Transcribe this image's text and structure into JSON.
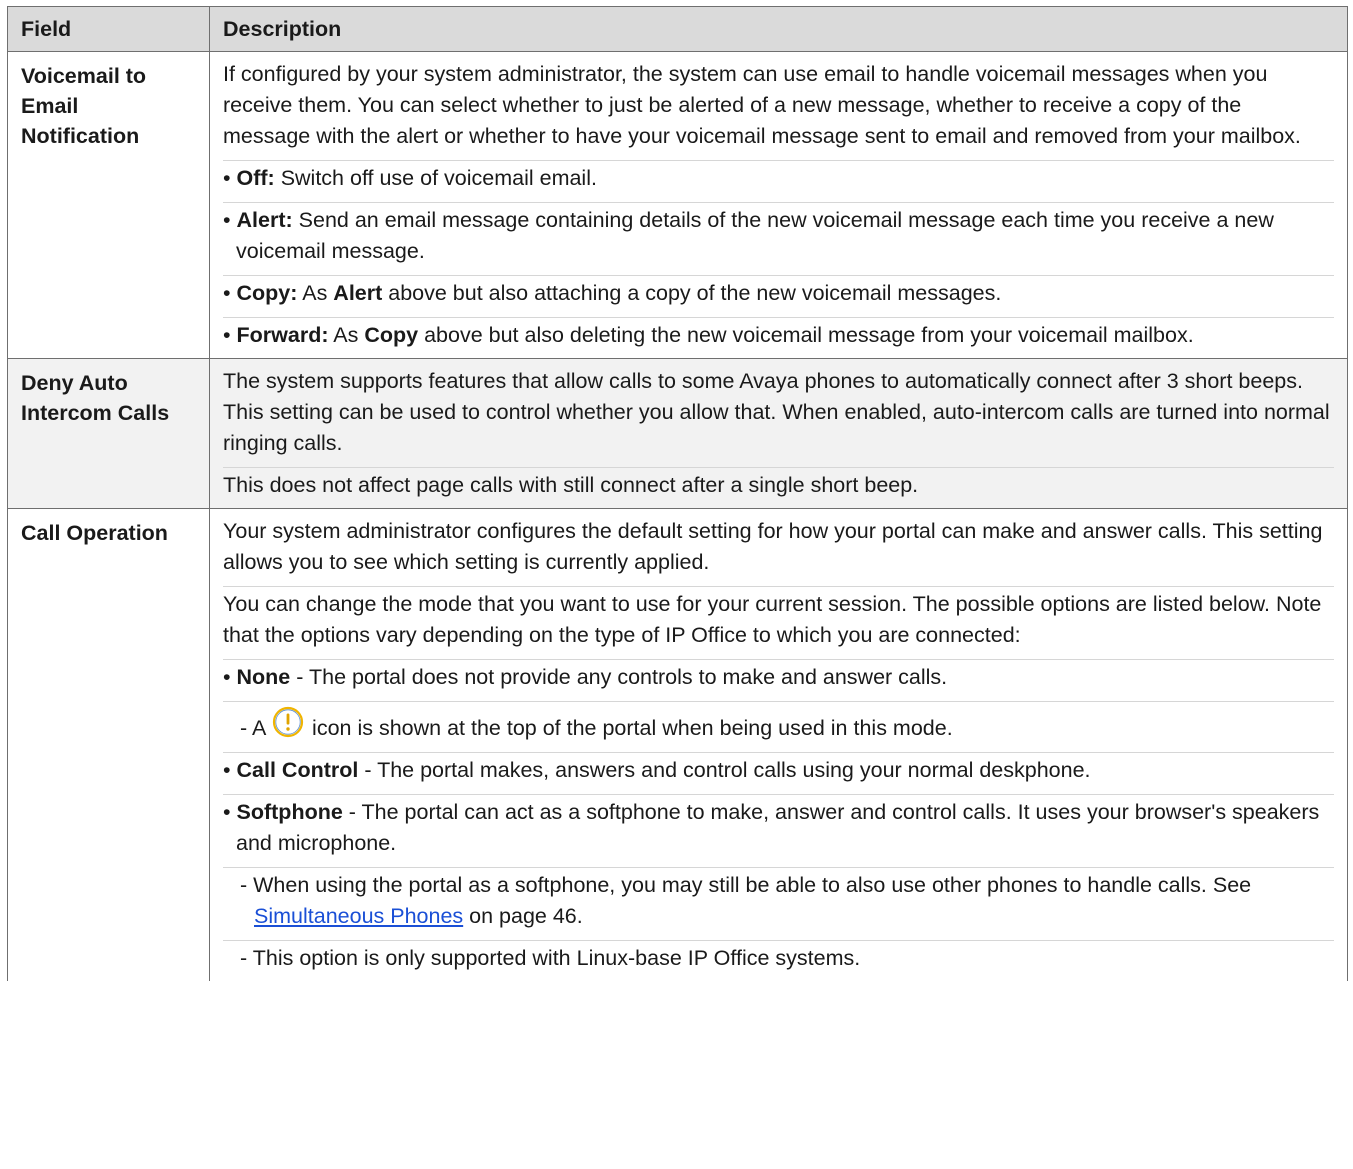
{
  "header": {
    "field": "Field",
    "description": "Description"
  },
  "rows": [
    {
      "field": "Voicemail to Email Notification",
      "intro": "If configured by your system administrator, the system can use email to handle voicemail messages when you receive them. You can select whether to just be alerted of a new message, whether to receive a copy of the message with the alert or whether to have your voicemail message sent to email and removed from your mailbox.",
      "options": [
        {
          "label": "Off:",
          "text": " Switch off use of voicemail email."
        },
        {
          "label": "Alert:",
          "text": " Send an email message containing details of the new voicemail message each time you receive a new voicemail message."
        },
        {
          "label": "Copy:",
          "text_a": " As ",
          "ref": "Alert",
          "text_b": " above but also attaching a copy of the new voicemail messages."
        },
        {
          "label": "Forward:",
          "text_a": " As ",
          "ref": "Copy",
          "text_b": " above but also deleting the new voicemail message from your voicemail mailbox."
        }
      ]
    },
    {
      "field": "Deny Auto Intercom Calls",
      "p1": "The system supports features that allow calls to some Avaya phones to automatically connect after 3 short beeps. This setting can be used to control whether you allow that. When enabled, auto-intercom calls are turned into normal ringing calls.",
      "p2": "This does not affect page calls with still connect after a single short beep."
    },
    {
      "field": "Call Operation",
      "p1": "Your system administrator configures the default setting for how your portal can make and answer calls. This setting allows you to see which setting is currently applied.",
      "p2": "You can change the mode that you want to use for your current session. The possible options are listed below. Note that the options vary depending on the type of IP Office to which you are connected:",
      "none_label": "None",
      "none_text": " - The portal does not provide any controls to make and answer calls.",
      "none_sub_a": "- A ",
      "none_sub_b": " icon is shown at the top of the portal when being used in this mode.",
      "cc_label": "Call Control",
      "cc_text": " - The portal makes, answers and control calls using your normal deskphone.",
      "sp_label": "Softphone",
      "sp_text": " - The portal can act as a softphone to make, answer and control calls. It uses your browser's speakers and microphone.",
      "sp_sub1_a": "- When using the portal as a softphone, you may still be able to also use other phones to handle calls. See ",
      "sp_sub1_link": "Simultaneous Phones",
      "sp_sub1_b": " on page 46.",
      "sp_sub2": "- This option is only supported with Linux-base IP Office systems."
    }
  ],
  "colors": {
    "header_bg": "#dadada",
    "shaded_row": "#f2f2f2",
    "link": "#1a4fd6",
    "icon_ring": "#f0b400"
  },
  "icons": {
    "none_mode_icon": "exclamation-circle-icon"
  }
}
